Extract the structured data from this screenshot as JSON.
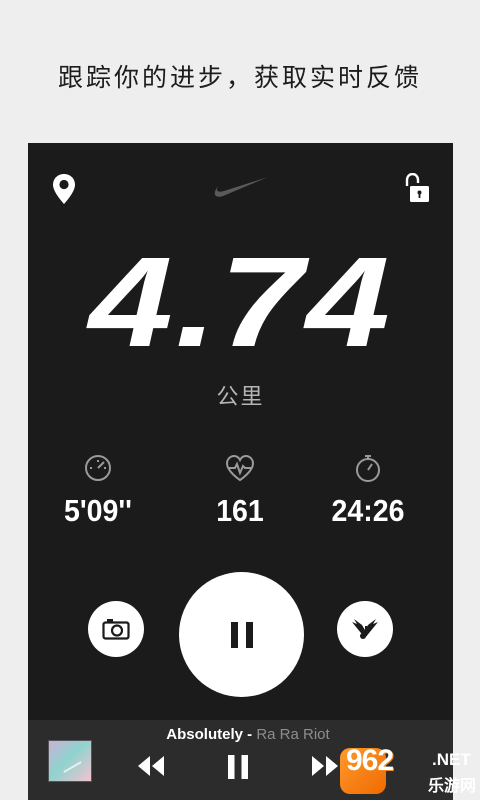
{
  "caption": "跟踪你的进步，获取实时反馈",
  "header": {
    "location_icon": "location-pin-icon",
    "logo_icon": "nike-swoosh-logo",
    "lock_icon": "unlock-icon"
  },
  "run": {
    "distance": "4.74",
    "unit": "公里"
  },
  "stats": {
    "pace": {
      "icon": "speedometer-icon",
      "value": "5'09''"
    },
    "heart_rate": {
      "icon": "heart-rate-icon",
      "value": "161"
    },
    "duration": {
      "icon": "stopwatch-icon",
      "value": "24:26"
    }
  },
  "controls": {
    "camera_icon": "camera-icon",
    "pause_icon": "pause-icon",
    "music_icon": "powersong-wings-icon"
  },
  "player": {
    "title": "Absolutely",
    "separator": " - ",
    "artist": "Ra Ra Riot",
    "prev_icon": "rewind-icon",
    "pause_icon": "pause-icon",
    "next_icon": "fast-forward-icon"
  },
  "watermark": {
    "number": "962",
    "domain": ".NET",
    "name": "乐游网"
  },
  "colors": {
    "page_bg": "#eeeeee",
    "screen_bg": "#1b1b1b",
    "player_bg": "#2c2c2c",
    "accent_white": "#ffffff",
    "muted_text": "#8d8d8d",
    "watermark_orange": "#f07a10"
  }
}
